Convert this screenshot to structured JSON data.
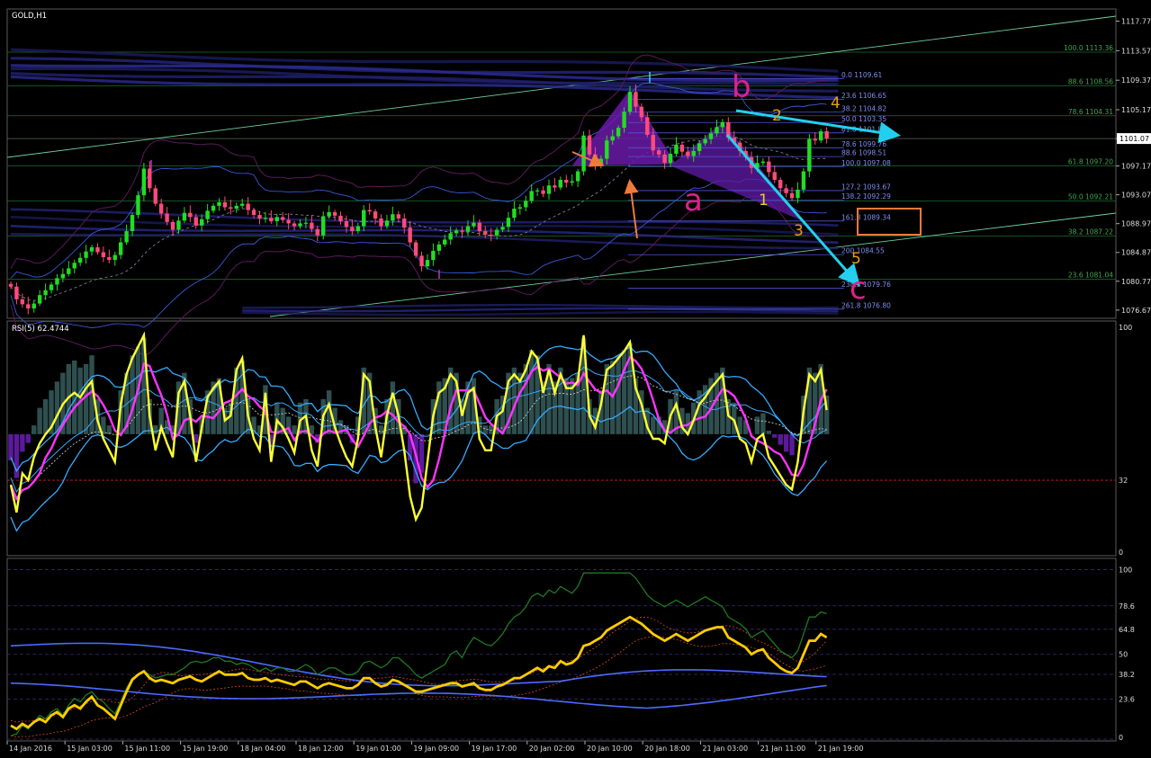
{
  "window": {
    "symbol_label": "GOLD,H1",
    "rsi_label": "RSI(5) 62.4744"
  },
  "chart_data": [
    {
      "type": "candlestick",
      "panel": "price",
      "title": "GOLD,H1",
      "ylim": [
        1075.5,
        1119.5
      ],
      "price_scale": [
        "1117.77",
        "1113.57",
        "1109.37",
        "1105.17",
        "1101.07",
        "1097.17",
        "1093.07",
        "1088.97",
        "1084.87",
        "1080.77",
        "1076.67"
      ],
      "current_price": "1101.07",
      "x_ticks": [
        "14 Jan 2016",
        "15 Jan 03:00",
        "15 Jan 11:00",
        "15 Jan 19:00",
        "18 Jan 04:00",
        "18 Jan 12:00",
        "19 Jan 01:00",
        "19 Jan 09:00",
        "19 Jan 17:00",
        "20 Jan 02:00",
        "20 Jan 10:00",
        "20 Jan 18:00",
        "21 Jan 03:00",
        "21 Jan 11:00",
        "21 Jan 19:00"
      ],
      "closes": [
        1080.0,
        1078.2,
        1077.5,
        1076.9,
        1077.6,
        1078.8,
        1079.5,
        1080.3,
        1081.2,
        1081.8,
        1082.6,
        1083.4,
        1084.1,
        1085.0,
        1085.6,
        1084.9,
        1084.2,
        1083.8,
        1084.5,
        1086.3,
        1087.9,
        1090.2,
        1093.0,
        1096.8,
        1094.0,
        1091.8,
        1090.4,
        1089.2,
        1088.1,
        1089.4,
        1090.5,
        1089.9,
        1088.7,
        1089.6,
        1090.8,
        1091.5,
        1092.0,
        1091.3,
        1091.1,
        1091.5,
        1091.8,
        1090.9,
        1090.2,
        1089.7,
        1089.8,
        1089.3,
        1089.9,
        1089.5,
        1089.0,
        1088.6,
        1089.0,
        1089.1,
        1088.2,
        1087.3,
        1090.0,
        1090.6,
        1090.1,
        1089.3,
        1088.5,
        1087.9,
        1088.6,
        1090.9,
        1090.7,
        1089.7,
        1088.6,
        1089.4,
        1090.3,
        1089.7,
        1088.4,
        1086.3,
        1084.4,
        1082.9,
        1083.8,
        1085.1,
        1086.0,
        1086.7,
        1087.6,
        1088.0,
        1087.8,
        1088.6,
        1089.1,
        1087.9,
        1087.4,
        1087.3,
        1088.1,
        1088.5,
        1089.8,
        1091.1,
        1091.3,
        1092.2,
        1093.6,
        1093.7,
        1093.2,
        1094.4,
        1094.1,
        1095.2,
        1094.8,
        1095.0,
        1096.4,
        1101.5,
        1098.8,
        1097.3,
        1098.2,
        1100.8,
        1101.4,
        1102.6,
        1104.9,
        1107.7,
        1105.6,
        1104.1,
        1101.6,
        1099.4,
        1098.8,
        1097.6,
        1098.9,
        1100.2,
        1099.2,
        1098.6,
        1099.3,
        1100.4,
        1101.0,
        1101.8,
        1102.7,
        1103.4,
        1101.2,
        1100.5,
        1099.3,
        1098.4,
        1096.9,
        1097.6,
        1097.8,
        1096.3,
        1095.2,
        1094.0,
        1093.3,
        1092.6,
        1093.8,
        1096.4,
        1101.0,
        1100.8,
        1102.1,
        1101.1
      ]
    },
    {
      "type": "histogram+line",
      "panel": "rsi",
      "title": "RSI(5) 62.4744",
      "ylim": [
        0,
        100
      ],
      "levels": [
        "100",
        "32",
        "0"
      ],
      "rsi_series": [
        30.0,
        18.0,
        35.0,
        32.0,
        42.0,
        48.0,
        52.0,
        55.0,
        60.0,
        65.0,
        68.0,
        70.0,
        68.0,
        72.0,
        75.0,
        58.0,
        50.0,
        45.0,
        40.0,
        65.0,
        78.0,
        85.0,
        90.0,
        95.0,
        60.0,
        45.0,
        55.0,
        48.0,
        42.0,
        70.0,
        75.0,
        60.0,
        40.0,
        55.0,
        68.0,
        72.0,
        75.0,
        58.0,
        60.0,
        80.0,
        85.0,
        60.0,
        50.0,
        45.0,
        70.0,
        40.0,
        58.0,
        55.0,
        50.0,
        44.0,
        58.0,
        60.0,
        45.0,
        38.0,
        60.0,
        65.0,
        55.0,
        48.0,
        42.0,
        38.0,
        50.0,
        78.0,
        75.0,
        55.0,
        42.0,
        60.0,
        70.0,
        60.0,
        45.0,
        25.0,
        15.0,
        20.0,
        40.0,
        60.0,
        70.0,
        72.0,
        78.0,
        75.0,
        60.0,
        70.0,
        72.0,
        50.0,
        45.0,
        45.0,
        60.0,
        62.0,
        75.0,
        78.0,
        75.0,
        80.0,
        88.0,
        85.0,
        70.0,
        80.0,
        70.0,
        78.0,
        72.0,
        72.0,
        75.0,
        95.0,
        60.0,
        55.0,
        65.0,
        80.0,
        82.0,
        85.0,
        88.0,
        92.0,
        72.0,
        65.0,
        55.0,
        50.0,
        50.0,
        48.0,
        60.0,
        65.0,
        55.0,
        52.0,
        58.0,
        65.0,
        68.0,
        72.0,
        75.0,
        78.0,
        60.0,
        58.0,
        50.0,
        48.0,
        40.0,
        50.0,
        52.0,
        42.0,
        38.0,
        34.0,
        30.0,
        28.0,
        40.0,
        62.0,
        78.0,
        75.0,
        80.0,
        62.4744
      ],
      "histogram": [
        -15,
        -25,
        -10,
        -5,
        5,
        15,
        20,
        25,
        30,
        35,
        40,
        42,
        38,
        40,
        45,
        20,
        10,
        5,
        0,
        25,
        35,
        45,
        50,
        55,
        20,
        5,
        15,
        8,
        5,
        30,
        35,
        20,
        -5,
        10,
        25,
        30,
        32,
        15,
        18,
        38,
        42,
        20,
        10,
        5,
        28,
        -8,
        18,
        15,
        10,
        5,
        18,
        20,
        5,
        -5,
        20,
        25,
        15,
        8,
        5,
        -5,
        10,
        38,
        35,
        15,
        5,
        20,
        30,
        20,
        5,
        -15,
        -28,
        -22,
        0,
        20,
        30,
        32,
        38,
        35,
        20,
        30,
        32,
        10,
        5,
        5,
        20,
        22,
        35,
        38,
        35,
        40,
        48,
        45,
        30,
        40,
        30,
        38,
        32,
        32,
        35,
        55,
        20,
        15,
        25,
        40,
        42,
        45,
        48,
        52,
        32,
        25,
        15,
        10,
        10,
        8,
        20,
        25,
        15,
        12,
        18,
        25,
        28,
        32,
        35,
        38,
        20,
        18,
        10,
        8,
        0,
        10,
        12,
        2,
        -2,
        -6,
        -10,
        -12,
        0,
        22,
        38,
        35,
        40,
        22
      ]
    },
    {
      "type": "line",
      "panel": "indicator3",
      "ylim": [
        0,
        105
      ],
      "levels": [
        "100",
        "78.6",
        "64.8",
        "50",
        "38.2",
        "23.6",
        "0"
      ],
      "main_series": [
        8.0,
        6.0,
        9.0,
        7.0,
        10.0,
        12.0,
        10.0,
        14.0,
        16.0,
        13.0,
        18.0,
        20.0,
        18.0,
        22.0,
        25.0,
        20.0,
        18.0,
        15.0,
        12.0,
        20.0,
        28.0,
        35.0,
        38.0,
        40.0,
        36.0,
        34.0,
        35.0,
        34.0,
        33.0,
        35.0,
        36.0,
        37.0,
        35.0,
        34.0,
        36.0,
        38.0,
        40.0,
        38.0,
        38.0,
        38.0,
        39.0,
        36.0,
        35.0,
        35.0,
        36.0,
        34.0,
        35.0,
        34.0,
        33.0,
        32.0,
        34.0,
        34.0,
        32.0,
        30.0,
        32.0,
        33.0,
        32.0,
        31.0,
        30.0,
        30.0,
        32.0,
        36.0,
        36.0,
        33.0,
        31.0,
        32.0,
        35.0,
        34.0,
        32.0,
        30.0,
        28.0,
        28.0,
        29.0,
        30.0,
        31.0,
        32.0,
        33.0,
        33.0,
        31.0,
        32.0,
        33.0,
        30.0,
        29.0,
        29.0,
        31.0,
        32.0,
        34.0,
        36.0,
        36.0,
        38.0,
        40.0,
        42.0,
        40.0,
        43.0,
        42.0,
        46.0,
        44.0,
        45.0,
        48.0,
        55.0,
        56.0,
        58.0,
        60.0,
        64.0,
        66.0,
        68.0,
        70.0,
        72.0,
        70.0,
        68.0,
        65.0,
        62.0,
        60.0,
        58.0,
        60.0,
        62.0,
        60.0,
        58.0,
        60.0,
        62.0,
        64.0,
        65.0,
        66.0,
        66.0,
        60.0,
        58.0,
        56.0,
        54.0,
        50.0,
        52.0,
        53.0,
        48.0,
        45.0,
        42.0,
        40.0,
        39.0,
        42.0,
        50.0,
        58.0,
        58.0,
        62.0,
        60.0
      ],
      "green_series": [
        2.0,
        3.0,
        8.0,
        6.0,
        10.0,
        14.0,
        12.0,
        16.0,
        18.0,
        14.0,
        20.0,
        24.0,
        22.0,
        26.0,
        28.0,
        24.0,
        22.0,
        18.0,
        15.0,
        22.0,
        30.0,
        36.0,
        38.0,
        40.0,
        38.0,
        36.0,
        37.0,
        38.0,
        38.0,
        40.0,
        42.0,
        45.0,
        46.0,
        45.0,
        46.0,
        48.0,
        48.0,
        46.0,
        46.0,
        44.0,
        45.0,
        44.0,
        42.0,
        40.0,
        42.0,
        40.0,
        42.0,
        42.0,
        40.0,
        40.0,
        42.0,
        44.0,
        42.0,
        38.0,
        40.0,
        42.0,
        42.0,
        40.0,
        38.0,
        38.0,
        40.0,
        45.0,
        46.0,
        44.0,
        42.0,
        44.0,
        48.0,
        48.0,
        45.0,
        42.0,
        38.0,
        36.0,
        38.0,
        40.0,
        42.0,
        44.0,
        50.0,
        52.0,
        48.0,
        55.0,
        60.0,
        58.0,
        56.0,
        55.0,
        58.0,
        62.0,
        68.0,
        72.0,
        74.0,
        78.0,
        84.0,
        86.0,
        84.0,
        88.0,
        86.0,
        90.0,
        88.0,
        86.0,
        90.0,
        98.0,
        98.0,
        98.0,
        98.0,
        98.0,
        98.0,
        98.0,
        98.0,
        98.0,
        95.0,
        90.0,
        85.0,
        82.0,
        80.0,
        78.0,
        80.0,
        82.0,
        80.0,
        78.0,
        80.0,
        82.0,
        84.0,
        82.0,
        80.0,
        78.0,
        72.0,
        70.0,
        68.0,
        65.0,
        60.0,
        62.0,
        64.0,
        60.0,
        56.0,
        52.0,
        50.0,
        48.0,
        52.0,
        62.0,
        72.0,
        72.0,
        75.0,
        74.0
      ]
    }
  ],
  "annotations": {
    "elliott_labels": [
      "a",
      "b",
      "c"
    ],
    "wave_numbers": [
      "1",
      "2",
      "3",
      "4",
      "5"
    ],
    "fib_right": [
      {
        "label": "100.0 1113.36",
        "price": 1113.36
      },
      {
        "label": "88.6 1108.56",
        "price": 1108.56
      },
      {
        "label": "78.6 1104.31",
        "price": 1104.31
      },
      {
        "label": "61.8 1097.20",
        "price": 1097.2
      },
      {
        "label": "50.0 1092.21",
        "price": 1092.21
      },
      {
        "label": "38.2 1087.22",
        "price": 1087.22
      },
      {
        "label": "23.6 1081.04",
        "price": 1081.04
      }
    ],
    "fib_mid": [
      {
        "label": "0.0 1109.61",
        "price": 1109.61
      },
      {
        "label": "23.6 1106.65",
        "price": 1106.65
      },
      {
        "label": "38.2 1104.82",
        "price": 1104.82
      },
      {
        "label": "50.0 1103.35",
        "price": 1103.35
      },
      {
        "label": "61.8 1101.87",
        "price": 1101.87
      },
      {
        "label": "78.6 1099.76",
        "price": 1099.76
      },
      {
        "label": "88.6 1098.51",
        "price": 1098.51
      },
      {
        "label": "100.0 1097.08",
        "price": 1097.08
      },
      {
        "label": "127.2 1093.67",
        "price": 1093.67
      },
      {
        "label": "138.2 1092.29",
        "price": 1092.29
      },
      {
        "label": "161.8 1089.34",
        "price": 1089.34
      },
      {
        "label": "200 1084.55",
        "price": 1084.55
      },
      {
        "label": "238.2 1079.76",
        "price": 1079.76
      },
      {
        "label": "261.8 1076.80",
        "price": 1076.8
      }
    ]
  },
  "colors": {
    "bull": "#22dd22",
    "bear": "#ff4a7a",
    "rsi_line": "#ffff33",
    "rsi_ma": "#ff33ff",
    "bands": "#33aaff",
    "hist_pos": "#2f4f4f",
    "hist_neg": "#5a1a9a",
    "ind3_main": "#ffcc00",
    "ind3_green": "#1e7a1e",
    "ind3_blue": "#4d6bff",
    "grid_green": "#1a6e2a",
    "fib_blue": "#4f55d8",
    "label_magenta": "#e0208a",
    "label_orange": "#e8a010",
    "arrow_cyan": "#22d0ee"
  }
}
